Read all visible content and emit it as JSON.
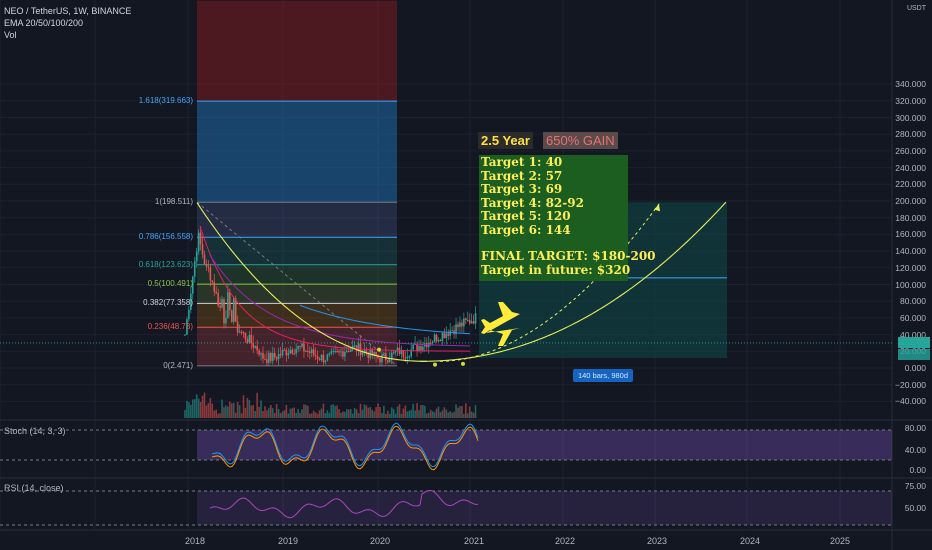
{
  "header": {
    "symbol_line": "NEO / TetherUS, 1W, BINANCE",
    "ema_label": "EMA 20/50/100/200",
    "vol_label": "Vol"
  },
  "panes": {
    "stoch_label": "Stoch (14, 3, 3)",
    "rsi_label": "RSI (14, close)"
  },
  "fib_levels": [
    {
      "label": "1.618(319.663)",
      "color": "#42a5f5"
    },
    {
      "label": "1(198.511)",
      "color": "#b2b5be"
    },
    {
      "label": "0.786(156.558)",
      "color": "#42a5f5"
    },
    {
      "label": "0.618(123.623)",
      "color": "#26a69a"
    },
    {
      "label": "0.5(100.491)",
      "color": "#8bc34a"
    },
    {
      "label": "0.382(77.358)",
      "color": "#d1d4dc"
    },
    {
      "label": "0.236(48.73)",
      "color": "#ef5350"
    },
    {
      "label": "0(2.471)",
      "color": "#b2b5be"
    }
  ],
  "annotations": {
    "duration": "2.5 Year",
    "gain": "650% GAIN",
    "targets": [
      "Target 1: 40",
      "Target 2: 57",
      "Target 3: 69",
      "Target 4: 82-92",
      "Target 5: 120",
      "Target 6: 144"
    ],
    "final_target": "FINAL TARGET: $180-200",
    "future_target": "Target in future: $320",
    "bars_badge": "140 bars, 980d"
  },
  "price_axis": {
    "currency": "USDT",
    "labels": [
      "340.000",
      "320.000",
      "300.000",
      "280.000",
      "260.000",
      "240.000",
      "220.000",
      "200.000",
      "180.000",
      "160.000",
      "140.000",
      "120.000",
      "100.000",
      "80.000",
      "60.000",
      "40.000",
      "20.000",
      "0.000",
      "−20.000",
      "−40.000"
    ],
    "stoch_labels": [
      "80.00",
      "40.00",
      "0.00"
    ],
    "rsi_labels": [
      "75.00",
      "50.00"
    ]
  },
  "time_axis": [
    "2018",
    "2019",
    "2020",
    "2021",
    "2022",
    "2023",
    "2024",
    "2025"
  ],
  "colors": {
    "background": "#131722",
    "bull": "#26a69a",
    "bear": "#ef5350",
    "target_box": "#1b5e20",
    "projection_box": "#0e4a48",
    "curve": "#e6ee5a",
    "airplane": "#ffeb3b"
  }
}
